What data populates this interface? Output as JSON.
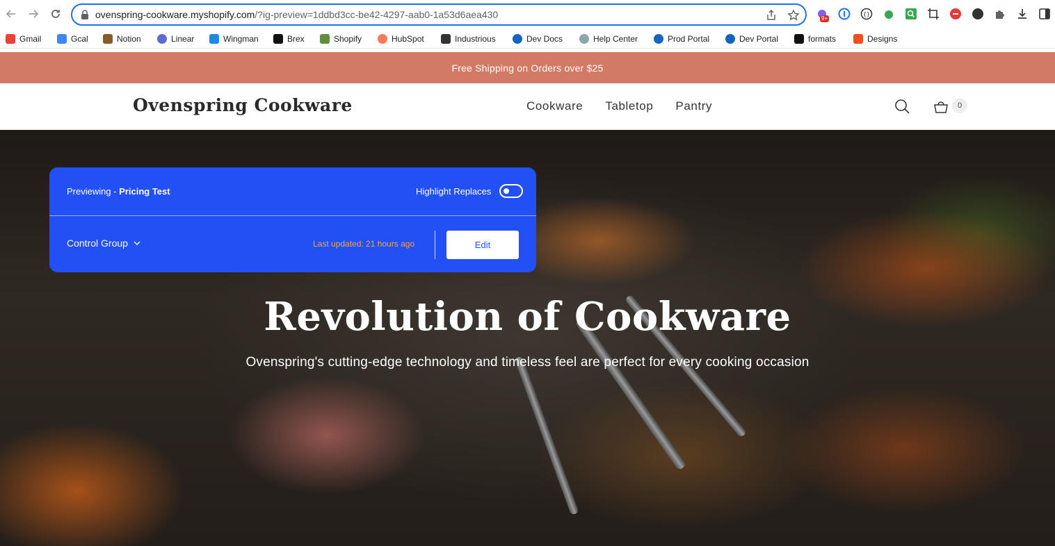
{
  "browser": {
    "url_host": "ovenspring-cookware.myshopify.com",
    "url_rest": "/?ig-preview=1ddbd3cc-be42-4297-aab0-1a53d6aea430",
    "extension_badge": "9+",
    "bookmarks": [
      {
        "label": "Gmail",
        "color": "#ea4335"
      },
      {
        "label": "Gcal",
        "color": "#4285f4"
      },
      {
        "label": "Notion",
        "color": "#8a5a2b"
      },
      {
        "label": "Linear",
        "color": "#5e6ad2"
      },
      {
        "label": "Wingman",
        "color": "#1e88e5"
      },
      {
        "label": "Brex",
        "color": "#111111"
      },
      {
        "label": "Shopify",
        "color": "#5e8e3e"
      },
      {
        "label": "HubSpot",
        "color": "#ff7a59"
      },
      {
        "label": "Industrious",
        "color": "#333333"
      },
      {
        "label": "Dev Docs",
        "color": "#1565c0"
      },
      {
        "label": "Help Center",
        "color": "#90a4ae"
      },
      {
        "label": "Prod Portal",
        "color": "#1565c0"
      },
      {
        "label": "Dev Portal",
        "color": "#1565c0"
      },
      {
        "label": "formats",
        "color": "#111111"
      },
      {
        "label": "Designs",
        "color": "#f24e1e"
      }
    ]
  },
  "announcement": "Free Shipping on Orders over $25",
  "store": {
    "logo": "Ovenspring Cookware",
    "nav": [
      "Cookware",
      "Tabletop",
      "Pantry"
    ],
    "cart_count": "0"
  },
  "hero": {
    "title": "Revolution of Cookware",
    "subtitle": "Ovenspring's cutting-edge technology and timeless feel are perfect for every cooking occasion"
  },
  "preview_panel": {
    "prefix": "Previewing - ",
    "test_name": "Pricing Test",
    "highlight_label": "Highlight Replaces",
    "highlight_on": false,
    "group": "Control Group",
    "last_updated": "Last updated: 21 hours ago",
    "edit_label": "Edit",
    "accent": "#2250f4",
    "updated_color": "#f6a33f"
  },
  "colors": {
    "announcement_bg": "#d37a66",
    "omnibox_border": "#1a73e8"
  }
}
